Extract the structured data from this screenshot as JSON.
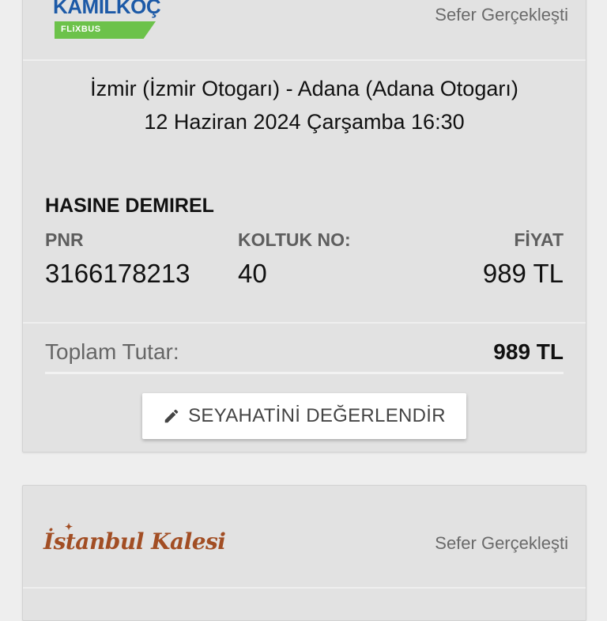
{
  "card1": {
    "brand": "KAMILKOÇ",
    "brand_sub": "FLiXBUS",
    "status": "Sefer Gerçekleşti",
    "route": "İzmir (İzmir Otogarı) - Adana (Adana Otogarı)",
    "datetime": "12 Haziran 2024 Çarşamba 16:30",
    "passenger_name": "HASINE DEMIREL",
    "pnr_label": "PNR",
    "pnr_value": "3166178213",
    "seat_label": "KOLTUK NO:",
    "seat_value": "40",
    "price_label": "FİYAT",
    "price_value": "989 TL",
    "total_label": "Toplam Tutar:",
    "total_value": "989 TL",
    "rate_button_label": "SEYAHATİNİ DEĞERLENDİR",
    "rate_button_icon": "pencil-icon"
  },
  "card2": {
    "brand": "İstanbul Kalesi",
    "status": "Sefer Gerçekleşti"
  },
  "colors": {
    "page_bg": "#eeeeee",
    "card_bg": "#e2e2e2",
    "kamilkoc_blue": "#1d5aa7",
    "flixbus_green": "#6cc24a",
    "istanbul_kalesi_brown": "#a24e24",
    "label_gray": "#5e5e5e"
  }
}
